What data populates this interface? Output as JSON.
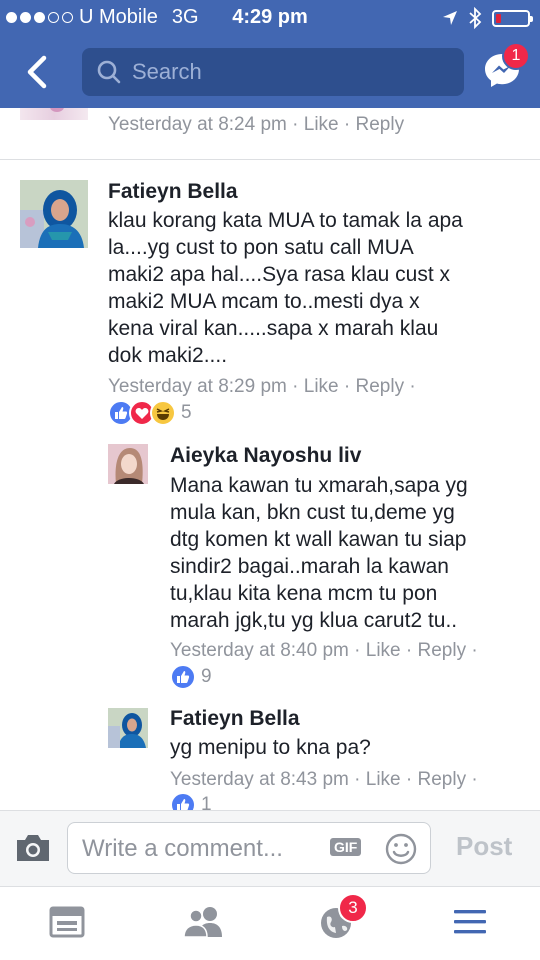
{
  "status_bar": {
    "carrier": "U Mobile",
    "network": "3G",
    "time": "4:29 pm",
    "signal_bars_filled": 3,
    "signal_bars_total": 5,
    "battery_level": 0.15,
    "icons": [
      "location-icon",
      "bluetooth-icon",
      "battery-icon"
    ]
  },
  "nav": {
    "search_placeholder": "Search",
    "messenger_badge": "1"
  },
  "previous_comment": {
    "time": "Yesterday at 8:24 pm",
    "like": "Like",
    "reply": "Reply"
  },
  "comments": [
    {
      "name": "Fatieyn Bella",
      "body_lines": [
        "klau korang kata MUA to tamak la apa",
        "la....yg cust to pon satu call MUA",
        "maki2 apa hal....Sya rasa klau cust x",
        "maki2 MUA mcam to..mesti dya x",
        "kena viral kan.....sapa x marah klau",
        "dok maki2...."
      ],
      "time": "Yesterday at 8:29 pm",
      "like": "Like",
      "reply": "Reply",
      "reactions": [
        "like",
        "love",
        "haha"
      ],
      "reaction_count": "5"
    },
    {
      "name": "Aieyka Nayoshu liv",
      "body_lines": [
        "Mana kawan tu xmarah,sapa yg",
        "mula kan, bkn cust tu,deme yg",
        "dtg komen kt wall kawan tu siap",
        "sindir2 bagai..marah la kawan",
        "tu,klau kita kena mcm tu pon",
        "marah jgk,tu yg klua carut2 tu.."
      ],
      "time": "Yesterday at 8:40 pm",
      "like": "Like",
      "reply": "Reply",
      "reactions": [
        "like"
      ],
      "reaction_count": "9"
    },
    {
      "name": "Fatieyn Bella",
      "body_lines": [
        "yg menipu to kna pa?"
      ],
      "time": "Yesterday at 8:43 pm",
      "like": "Like",
      "reply": "Reply",
      "reactions": [
        "like"
      ],
      "reaction_count": "1"
    }
  ],
  "composer": {
    "placeholder": "Write a comment...",
    "gif_label": "GIF",
    "post_label": "Post"
  },
  "tabbar": {
    "tabs": [
      "news-feed-icon",
      "friends-icon",
      "notifications-globe-icon",
      "menu-icon"
    ],
    "notifications_badge": "3"
  },
  "colors": {
    "brand_blue": "#4267b2",
    "search_bg": "#2e4f8e",
    "badge_red": "#f02849",
    "meta_gray": "#90949c",
    "tab_active": "#4267b2"
  }
}
